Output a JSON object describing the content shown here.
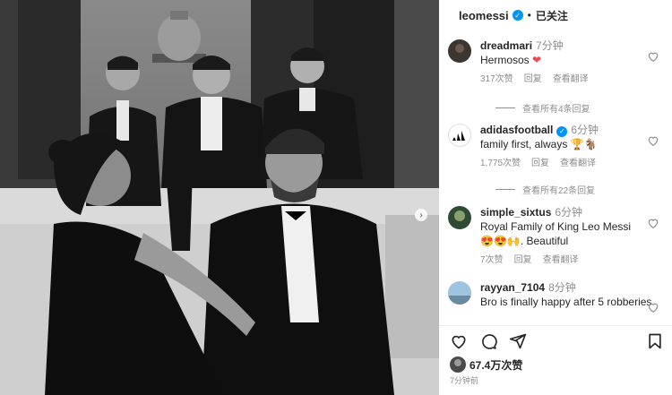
{
  "post": {
    "username": "leomessi",
    "separator": "•",
    "follow_status": "已关注",
    "carousel_next": "›"
  },
  "comments": [
    {
      "username": "dreadmari",
      "time": "7分钟",
      "text": "Hermosos",
      "likes": "317次赞",
      "reply": "回复",
      "translate": "查看翻译",
      "avatar": "dark-avatar"
    },
    {
      "username": "adidasfootball",
      "time": "6分钟",
      "text": "family first, always",
      "likes": "1,775次赞",
      "reply": "回复",
      "translate": "查看翻译",
      "avatar": "adidas-logo",
      "verified": true
    },
    {
      "username": "simple_sixtus",
      "time": "6分钟",
      "text": "Royal Family of King Leo Messi",
      "text2": ". Beautiful",
      "likes": "7次赞",
      "reply": "回复",
      "translate": "查看翻译",
      "avatar": "green-avatar"
    },
    {
      "username": "rayyan_7104",
      "time": "8分钟",
      "text": "Bro is finally happy after 5 robberies",
      "avatar": "sky-avatar"
    }
  ],
  "view_replies": [
    "查看所有4条回复",
    "查看所有22条回复"
  ],
  "actions": {
    "likes": "67.4万次赞",
    "time": "7分钟前",
    "icons": [
      "heart-icon",
      "comment-icon",
      "share-icon",
      "bookmark-icon"
    ]
  },
  "colors": {
    "verified": "#0095f6",
    "muted": "#8e8e8e",
    "text": "#262626",
    "heart_red": "#ed4956"
  }
}
